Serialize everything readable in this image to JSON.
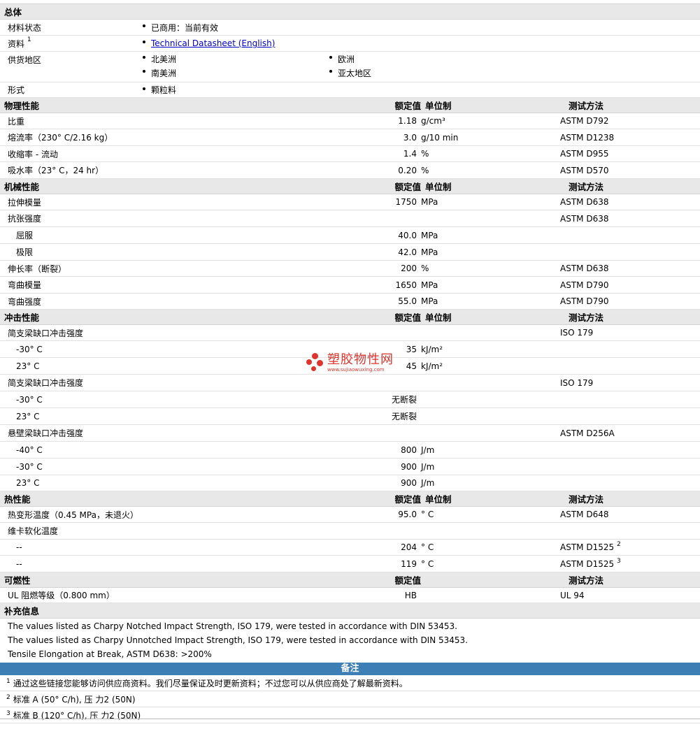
{
  "general": {
    "title": "总体",
    "status_label": "材料状态",
    "status_value": "已商用：当前有效",
    "docs_label": "资料",
    "docs_sup": "1",
    "docs_link": "Technical Datasheet (English)",
    "regions_label": "供货地区",
    "regions": [
      "北美洲",
      "欧洲",
      "南美洲",
      "亚太地区"
    ],
    "form_label": "形式",
    "form_value": "颗粒料"
  },
  "headers": {
    "nominal": "额定值",
    "unit": "单位制",
    "test": "测试方法"
  },
  "physical": {
    "title": "物理性能",
    "rows": [
      {
        "label": "比重",
        "value": "1.18",
        "unit": "g/cm³",
        "test": "ASTM D792"
      },
      {
        "label": "熔流率（230° C/2.16 kg）",
        "value": "3.0",
        "unit": "g/10 min",
        "test": "ASTM D1238"
      },
      {
        "label": "收缩率 - 流动",
        "value": "1.4",
        "unit": "%",
        "test": "ASTM D955"
      },
      {
        "label": "吸水率（23° C，24 hr）",
        "value": "0.20",
        "unit": "%",
        "test": "ASTM D570"
      }
    ]
  },
  "mechanical": {
    "title": "机械性能",
    "rows": [
      {
        "label": "拉伸模量",
        "value": "1750",
        "unit": "MPa",
        "test": "ASTM D638",
        "indent": false
      },
      {
        "label": "抗张强度",
        "value": "",
        "unit": "",
        "test": "ASTM D638",
        "indent": false
      },
      {
        "label": "屈服",
        "value": "40.0",
        "unit": "MPa",
        "test": "",
        "indent": true
      },
      {
        "label": "极限",
        "value": "42.0",
        "unit": "MPa",
        "test": "",
        "indent": true
      },
      {
        "label": "伸长率（断裂）",
        "value": "200",
        "unit": "%",
        "test": "ASTM D638",
        "indent": false
      },
      {
        "label": "弯曲模量",
        "value": "1650",
        "unit": "MPa",
        "test": "ASTM D790",
        "indent": false
      },
      {
        "label": "弯曲强度",
        "value": "55.0",
        "unit": "MPa",
        "test": "ASTM D790",
        "indent": false
      }
    ]
  },
  "impact": {
    "title": "冲击性能",
    "rows": [
      {
        "label": "简支梁缺口冲击强度",
        "value": "",
        "unit": "",
        "test": "ISO 179",
        "indent": false
      },
      {
        "label": "-30° C",
        "value": "35",
        "unit": "kJ/m²",
        "test": "",
        "indent": true
      },
      {
        "label": "23° C",
        "value": "45",
        "unit": "kJ/m²",
        "test": "",
        "indent": true
      },
      {
        "label": "简支梁缺口冲击强度",
        "value": "",
        "unit": "",
        "test": "ISO 179",
        "indent": false
      },
      {
        "label": "-30° C",
        "value": "无断裂",
        "unit": "",
        "test": "",
        "indent": true
      },
      {
        "label": "23° C",
        "value": "无断裂",
        "unit": "",
        "test": "",
        "indent": true
      },
      {
        "label": "悬壁梁缺口冲击强度",
        "value": "",
        "unit": "",
        "test": "ASTM D256A",
        "indent": false
      },
      {
        "label": "-40° C",
        "value": "800",
        "unit": "J/m",
        "test": "",
        "indent": true
      },
      {
        "label": "-30° C",
        "value": "900",
        "unit": "J/m",
        "test": "",
        "indent": true
      },
      {
        "label": "23° C",
        "value": "900",
        "unit": "J/m",
        "test": "",
        "indent": true
      }
    ]
  },
  "thermal": {
    "title": "热性能",
    "rows": [
      {
        "label": "热变形温度（0.45 MPa，未退火）",
        "value": "95.0",
        "unit": "° C",
        "test": "ASTM D648",
        "sup": "",
        "indent": false
      },
      {
        "label": "维卡软化温度",
        "value": "",
        "unit": "",
        "test": "",
        "sup": "",
        "indent": false
      },
      {
        "label": "--",
        "value": "204",
        "unit": "° C",
        "test": "ASTM D1525",
        "sup": "2",
        "indent": true
      },
      {
        "label": "--",
        "value": "119",
        "unit": "° C",
        "test": "ASTM D1525",
        "sup": "3",
        "indent": true
      }
    ]
  },
  "flammability": {
    "title": "可燃性",
    "rows": [
      {
        "label": "UL 阻燃等级（0.800 mm）",
        "value": "HB",
        "unit": "",
        "test": "UL 94"
      }
    ]
  },
  "supplement": {
    "title": "补充信息",
    "lines": [
      "The values listed as Charpy Notched Impact Strength, ISO 179, were tested in accordance with DIN 53453.",
      "The values listed as Charpy Unnotched Impact Strength, ISO 179, were tested in accordance with DIN 53453.",
      "Tensile Elongation at Break, ASTM D638: >200%"
    ]
  },
  "remarks": {
    "title": "备注",
    "notes": [
      {
        "num": "1",
        "text": "通过这些链接您能够访问供应商资料。我们尽量保证及时更新资料；不过您可以从供应商处了解最新资料。"
      },
      {
        "num": "2",
        "text": "标准 A (50° C/h), 压 力2 (50N)"
      },
      {
        "num": "3",
        "text": "标准 B (120° C/h), 压 力2 (50N)"
      }
    ]
  },
  "watermark": {
    "main": "塑胶物性网",
    "sub": "www.sujiaowuxing.com"
  }
}
